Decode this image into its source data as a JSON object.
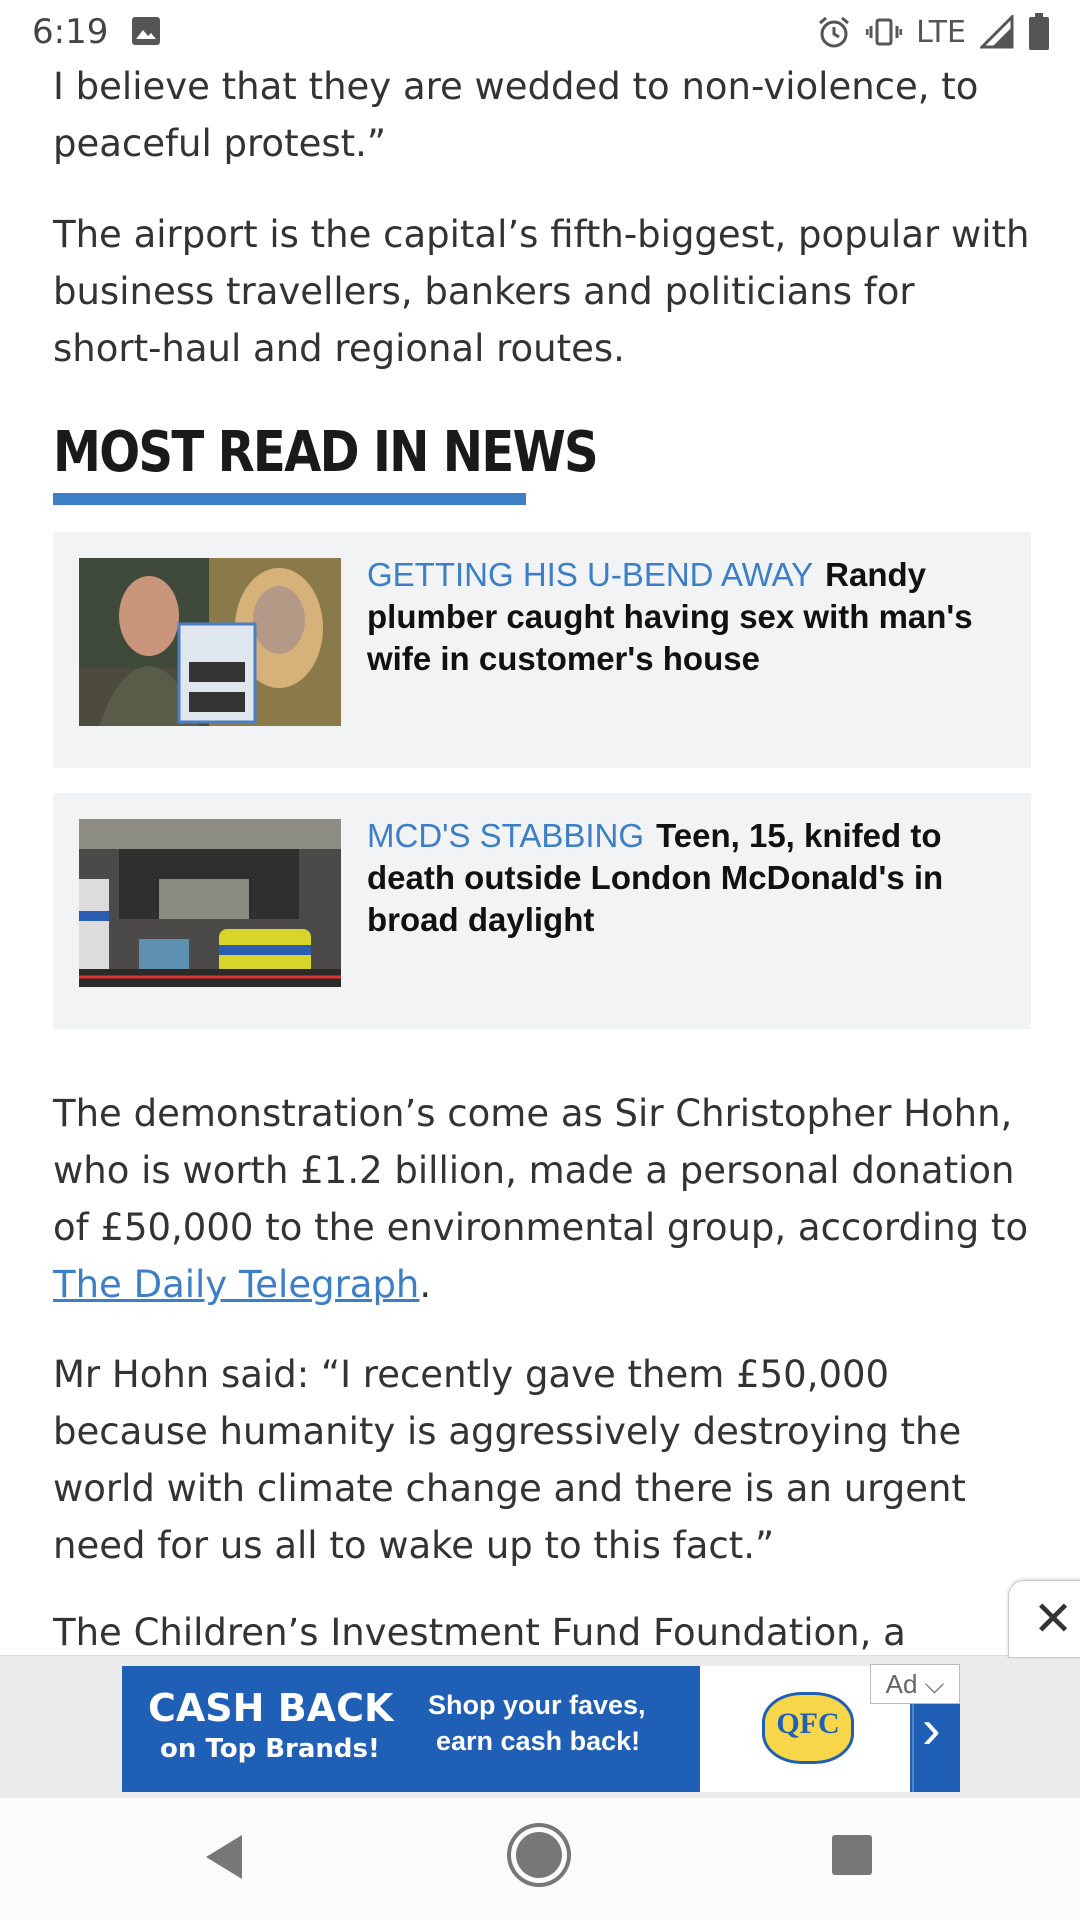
{
  "status_bar": {
    "time": "6:19",
    "network": "LTE",
    "icons": [
      "image-icon",
      "alarm-icon",
      "vibrate-icon",
      "signal-icon",
      "battery-icon"
    ]
  },
  "article": {
    "para1": "I believe that they are wedded to non-violence, to peaceful protest.”",
    "para2": "The airport is the capital’s fifth-biggest, popular with business travellers, bankers and politicians for short-haul and regional routes.",
    "para3_text": "The demonstration’s come as Sir Christopher Hohn, who is worth £1.2 billion, made a personal donation of £50,000 to the environmental group, according to ",
    "para3_link": "The Daily Telegraph",
    "para3_end": ".",
    "para4": "Mr Hohn said: “I recently gave them £50,000 because humanity is aggressively destroying the world with climate change and there is an urgent need for us all to wake up to this fact.”",
    "para5": "The Children’s Investment Fund Foundation, a"
  },
  "most_read": {
    "heading": "MOST READ IN NEWS",
    "accent_color": "#3c7fc6",
    "items": [
      {
        "kicker": "GETTING HIS U-BEND AWAY",
        "headline": "Randy plumber caught having sex with man's wife in customer's house"
      },
      {
        "kicker": "MCD'S STABBING",
        "headline": "Teen, 15, knifed to death outside London McDonald's in broad daylight"
      }
    ]
  },
  "ad": {
    "close_label": "✕",
    "choice_label": "Ad ⌵",
    "cash_line1": "CASH BACK",
    "cash_line2": "on Top Brands!",
    "shop_line1": "Shop your faves,",
    "shop_line2": "earn cash back!",
    "logo_text": "QFC",
    "brand_color": "#1f5fb5"
  },
  "nav_bar": {
    "icons": [
      "back-icon",
      "home-icon",
      "recents-icon"
    ]
  }
}
